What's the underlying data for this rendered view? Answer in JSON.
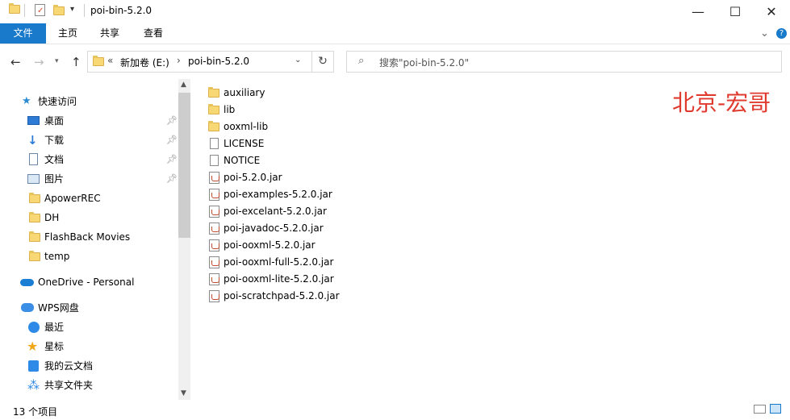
{
  "window": {
    "title": "poi-bin-5.2.0",
    "minimize_glyph": "—",
    "maximize_glyph": "☐",
    "close_glyph": "✕"
  },
  "ribbon": {
    "tabs": [
      "文件",
      "主页",
      "共享",
      "查看"
    ],
    "expand_glyph": "⌄",
    "help_glyph": "?"
  },
  "address": {
    "prefix": "«",
    "drive": "新加卷 (E:)",
    "separator": "›",
    "folder": "poi-bin-5.2.0"
  },
  "search": {
    "placeholder": "搜索\"poi-bin-5.2.0\""
  },
  "nav": {
    "quick_access": "快速访问",
    "items": [
      {
        "label": "桌面",
        "icon": "desktop-icon",
        "pinned": true
      },
      {
        "label": "下载",
        "icon": "download-icon",
        "pinned": true
      },
      {
        "label": "文档",
        "icon": "documents-icon",
        "pinned": true
      },
      {
        "label": "图片",
        "icon": "pictures-icon",
        "pinned": true
      },
      {
        "label": "ApowerREC",
        "icon": "folder-icon",
        "pinned": false
      },
      {
        "label": "DH",
        "icon": "folder-icon",
        "pinned": false
      },
      {
        "label": "FlashBack Movies",
        "icon": "folder-icon",
        "pinned": false
      },
      {
        "label": "temp",
        "icon": "folder-icon",
        "pinned": false
      }
    ],
    "onedrive": "OneDrive - Personal",
    "wps": "WPS网盘",
    "wps_items": [
      {
        "label": "最近",
        "icon": "recent-icon"
      },
      {
        "label": "星标",
        "icon": "star-icon"
      },
      {
        "label": "我的云文档",
        "icon": "cloud-docs-icon"
      },
      {
        "label": "共享文件夹",
        "icon": "shared-folder-icon"
      }
    ]
  },
  "files": [
    {
      "name": "auxiliary",
      "type": "folder"
    },
    {
      "name": "lib",
      "type": "folder"
    },
    {
      "name": "ooxml-lib",
      "type": "folder"
    },
    {
      "name": "LICENSE",
      "type": "file"
    },
    {
      "name": "NOTICE",
      "type": "file"
    },
    {
      "name": "poi-5.2.0.jar",
      "type": "jar"
    },
    {
      "name": "poi-examples-5.2.0.jar",
      "type": "jar"
    },
    {
      "name": "poi-excelant-5.2.0.jar",
      "type": "jar"
    },
    {
      "name": "poi-javadoc-5.2.0.jar",
      "type": "jar"
    },
    {
      "name": "poi-ooxml-5.2.0.jar",
      "type": "jar"
    },
    {
      "name": "poi-ooxml-full-5.2.0.jar",
      "type": "jar"
    },
    {
      "name": "poi-ooxml-lite-5.2.0.jar",
      "type": "jar"
    },
    {
      "name": "poi-scratchpad-5.2.0.jar",
      "type": "jar"
    }
  ],
  "watermark": "北京-宏哥",
  "status": {
    "count": "13 个项目"
  },
  "colors": {
    "accent": "#1979ca",
    "folder": "#f8d775",
    "watermark": "#e03a2f"
  }
}
